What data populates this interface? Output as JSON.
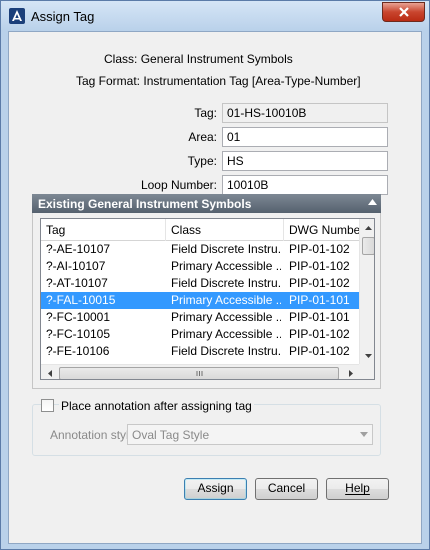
{
  "window": {
    "title": "Assign Tag"
  },
  "info": {
    "class_label": "Class:",
    "class_value": "General Instrument Symbols",
    "tag_format_label": "Tag Format:",
    "tag_format_value": "Instrumentation Tag [Area-Type-Number]"
  },
  "form": {
    "tag_label": "Tag:",
    "tag_value": "01-HS-10010B",
    "area_label": "Area:",
    "area_value": "01",
    "type_label": "Type:",
    "type_value": "HS",
    "loop_label": "Loop Number:",
    "loop_value": "10010B"
  },
  "existing": {
    "header": "Existing General Instrument Symbols",
    "columns": [
      "Tag",
      "Class",
      "DWG Number"
    ],
    "rows": [
      {
        "tag": "?-AE-10107",
        "cls": "Field Discrete Instru...",
        "dwg": "PIP-01-102"
      },
      {
        "tag": "?-AI-10107",
        "cls": "Primary Accessible ...",
        "dwg": "PIP-01-102"
      },
      {
        "tag": "?-AT-10107",
        "cls": "Field Discrete Instru...",
        "dwg": "PIP-01-102"
      },
      {
        "tag": "?-FAL-10015",
        "cls": "Primary Accessible ...",
        "dwg": "PIP-01-101",
        "selected": true
      },
      {
        "tag": "?-FC-10001",
        "cls": "Primary Accessible ...",
        "dwg": "PIP-01-101"
      },
      {
        "tag": "?-FC-10105",
        "cls": "Primary Accessible ...",
        "dwg": "PIP-01-102"
      },
      {
        "tag": "?-FE-10106",
        "cls": "Field Discrete Instru...",
        "dwg": "PIP-01-102"
      }
    ]
  },
  "annotation": {
    "checkbox_label": "Place annotation after assigning tag",
    "checked": false,
    "style_label": "Annotation style:",
    "style_value": "Oval Tag Style"
  },
  "buttons": {
    "assign": "Assign",
    "cancel": "Cancel",
    "help": "Help"
  },
  "colors": {
    "selection": "#3399ff",
    "group_header": "#5f6b78",
    "close_button": "#c9452e"
  }
}
